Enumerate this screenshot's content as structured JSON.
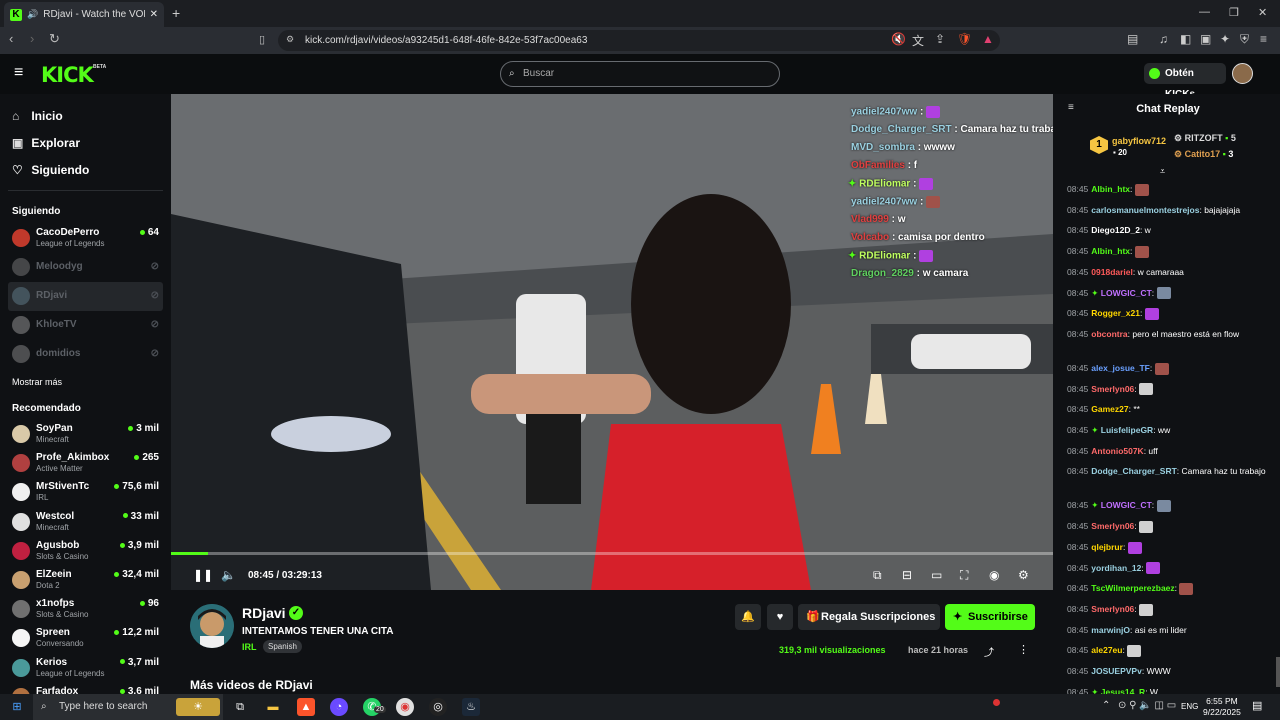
{
  "browser": {
    "tab_title": "RDjavi - Watch the VOD on K",
    "url": "kick.com/rdjavi/videos/a93245d1-648f-46fe-842e-53f7ac00ea63"
  },
  "header": {
    "logo": "KICK",
    "beta": "BETA",
    "search_placeholder": "Buscar",
    "kicks_button": "Obtén KICKs"
  },
  "sidebar": {
    "nav": [
      {
        "label": "Inicio",
        "icon": "home-icon"
      },
      {
        "label": "Explorar",
        "icon": "browse-icon"
      },
      {
        "label": "Siguiendo",
        "icon": "heart-icon"
      }
    ],
    "following_title": "Siguiendo",
    "following": [
      {
        "name": "CacoDePerro",
        "category": "League of Legends",
        "viewers": "64",
        "live": true,
        "color": "#c0392b"
      },
      {
        "name": "Meloodyg",
        "category": "",
        "viewers": "",
        "live": false,
        "color": "#888888"
      },
      {
        "name": "RDjavi",
        "category": "",
        "viewers": "",
        "live": false,
        "color": "#6a8a9a"
      },
      {
        "name": "KhloeTV",
        "category": "",
        "viewers": "",
        "live": false,
        "color": "#aaaaaa"
      },
      {
        "name": "domidios",
        "category": "",
        "viewers": "",
        "live": false,
        "color": "#999999"
      }
    ],
    "show_more": "Mostrar más",
    "recommended_title": "Recomendado",
    "recommended": [
      {
        "name": "SoyPan",
        "category": "Minecraft",
        "viewers": "3 mil",
        "color": "#d9c9a8"
      },
      {
        "name": "Profe_Akimbox",
        "category": "Active Matter",
        "viewers": "265",
        "color": "#b04040"
      },
      {
        "name": "MrStivenTc",
        "category": "IRL",
        "viewers": "75,6 mil",
        "color": "#f0f0f0"
      },
      {
        "name": "Westcol",
        "category": "Minecraft",
        "viewers": "33 mil",
        "color": "#e0e0e0"
      },
      {
        "name": "Agusbob",
        "category": "Slots & Casino",
        "viewers": "3,9 mil",
        "color": "#c02040"
      },
      {
        "name": "ElZeein",
        "category": "Dota 2",
        "viewers": "32,4 mil",
        "color": "#c8a070"
      },
      {
        "name": "x1nofps",
        "category": "Slots & Casino",
        "viewers": "96",
        "color": "#707070"
      },
      {
        "name": "Spreen",
        "category": "Conversando",
        "viewers": "12,2 mil",
        "color": "#f5f5f5"
      },
      {
        "name": "Kerios",
        "category": "League of Legends",
        "viewers": "3,7 mil",
        "color": "#4a9a9a"
      },
      {
        "name": "Farfadox",
        "category": "",
        "viewers": "3,6 mil",
        "color": "#b07040"
      }
    ]
  },
  "video": {
    "overlay_chat": [
      {
        "user": "yadiel2407ww",
        "text": ":",
        "color": "#9ad0e0",
        "badge": false
      },
      {
        "user": "Dodge_Charger_SRT",
        "text": ": Camara haz tu trabajo",
        "color": "#9ad0e0",
        "badge": false
      },
      {
        "user": "MVD_sombra",
        "text": ": wwww",
        "color": "#9ad0e0",
        "badge": false
      },
      {
        "user": "ObFamilies",
        "text": ": f",
        "color": "#e04040",
        "badge": false
      },
      {
        "user": "RDEliomar",
        "text": ":",
        "color": "#c0ff60",
        "badge": true
      },
      {
        "user": "yadiel2407ww",
        "text": ":",
        "color": "#9ad0e0",
        "badge": false
      },
      {
        "user": "Vlad999",
        "text": ": w",
        "color": "#e04040",
        "badge": false
      },
      {
        "user": "Volcabo",
        "text": ": camisa por dentro",
        "color": "#e04040",
        "badge": false
      },
      {
        "user": "RDEliomar",
        "text": ":",
        "color": "#c0ff60",
        "badge": true
      },
      {
        "user": "Dragon_2829",
        "text": ": w camara",
        "color": "#60d060",
        "badge": false
      }
    ],
    "progress": 0.042,
    "time": "08:45 / 03:29:13"
  },
  "info": {
    "channel": "RDjavi",
    "title": "INTENTAMOS TENER UNA CITA",
    "category": "IRL",
    "language": "Spanish",
    "gift_button": "Regala Suscripciones",
    "subscribe_button": "Suscribirse",
    "views": "319,3 mil visualizaciones",
    "ago": "hace 21 horas",
    "more_videos": "Más videos de RDjavi"
  },
  "chat": {
    "title": "Chat Replay",
    "leaderboard": [
      {
        "rank": "1",
        "name": "gabyflow712",
        "value": "20",
        "color": "#f5c542"
      },
      {
        "rank": "",
        "name": "RITZOFT",
        "value": "5",
        "color": "#dddddd"
      },
      {
        "rank": "",
        "name": "Catito17",
        "value": "3",
        "color": "#e0a050"
      }
    ],
    "messages": [
      {
        "time": "08:45",
        "user": "Albin_htx",
        "text": ":",
        "color": "#53fc18",
        "emote": "#a0524a",
        "badge": false
      },
      {
        "time": "08:45",
        "user": "carlosmanuelmontestrejos",
        "text": ": bajajajaja",
        "color": "#9ad0e0",
        "emote": "",
        "badge": false
      },
      {
        "time": "08:45",
        "user": "Diego12D_2",
        "text": ": w",
        "color": "#ffffff",
        "emote": "",
        "badge": false
      },
      {
        "time": "08:45",
        "user": "Albin_htx",
        "text": ":",
        "color": "#53fc18",
        "emote": "#a0524a",
        "badge": false
      },
      {
        "time": "08:45",
        "user": "0918dariel",
        "text": ": w camaraaa",
        "color": "#ff5a5a",
        "emote": "",
        "badge": false
      },
      {
        "time": "08:45",
        "user": "LOWGIC_CT",
        "text": ":",
        "color": "#c070ff",
        "emote": "#7a8aa0",
        "badge": true
      },
      {
        "time": "08:45",
        "user": "Rogger_x21",
        "text": ":",
        "color": "#ffd700",
        "emote": "#b040e0",
        "badge": false
      },
      {
        "time": "08:45",
        "user": "obcontra",
        "text": ": pero el maestro está en flow",
        "color": "#ff6a6a",
        "emote": "",
        "badge": false
      },
      {
        "time": "08:45",
        "user": "alex_josue_TF",
        "text": ":",
        "color": "#6aa0ff",
        "emote": "#a0524a",
        "badge": false
      },
      {
        "time": "08:45",
        "user": "Smerlyn06",
        "text": ":",
        "color": "#ff6a6a",
        "emote": "#d0d0d0",
        "badge": false
      },
      {
        "time": "08:45",
        "user": "Gamez27",
        "text": ": **",
        "color": "#ffd700",
        "emote": "",
        "badge": false
      },
      {
        "time": "08:45",
        "user": "LuisfelipeGR",
        "text": ": ww",
        "color": "#9ad0e0",
        "emote": "",
        "badge": true
      },
      {
        "time": "08:45",
        "user": "Antonio507K",
        "text": ": uff",
        "color": "#ff6a6a",
        "emote": "",
        "badge": false
      },
      {
        "time": "08:45",
        "user": "Dodge_Charger_SRT",
        "text": ": Camara haz tu trabajo",
        "color": "#9ad0e0",
        "emote": "",
        "badge": false
      },
      {
        "time": "08:45",
        "user": "LOWGIC_CT",
        "text": ":",
        "color": "#c070ff",
        "emote": "#7a8aa0",
        "badge": true
      },
      {
        "time": "08:45",
        "user": "Smerlyn06",
        "text": ":",
        "color": "#ff6a6a",
        "emote": "#d0d0d0",
        "badge": false
      },
      {
        "time": "08:45",
        "user": "qlejbrur",
        "text": ":",
        "color": "#ffd700",
        "emote": "#b040e0",
        "badge": false
      },
      {
        "time": "08:45",
        "user": "yordihan_12",
        "text": ":",
        "color": "#9ad0e0",
        "emote": "#b040e0",
        "badge": false
      },
      {
        "time": "08:45",
        "user": "TscWilmerperezbaez",
        "text": ":",
        "color": "#53fc18",
        "emote": "#a0524a",
        "badge": false
      },
      {
        "time": "08:45",
        "user": "Smerlyn06",
        "text": ":",
        "color": "#ff6a6a",
        "emote": "#d0d0d0",
        "badge": false
      },
      {
        "time": "08:45",
        "user": "marwinjO",
        "text": ": asi es mi lider",
        "color": "#9ad0e0",
        "emote": "",
        "badge": false
      },
      {
        "time": "08:45",
        "user": "ale27eu",
        "text": ":",
        "color": "#ffd700",
        "emote": "#d0d0d0",
        "badge": false
      },
      {
        "time": "08:45",
        "user": "JOSUEPVPv",
        "text": ": WWW",
        "color": "#9ad0e0",
        "emote": "",
        "badge": false
      },
      {
        "time": "08:45",
        "user": "Jesus14_R",
        "text": ": W",
        "color": "#53fc18",
        "emote": "",
        "badge": true
      }
    ]
  },
  "taskbar": {
    "search_placeholder": "Type here to search",
    "lang": "ENG",
    "time": "6:55 PM",
    "date": "9/22/2025",
    "whatsapp_badge": "20"
  }
}
